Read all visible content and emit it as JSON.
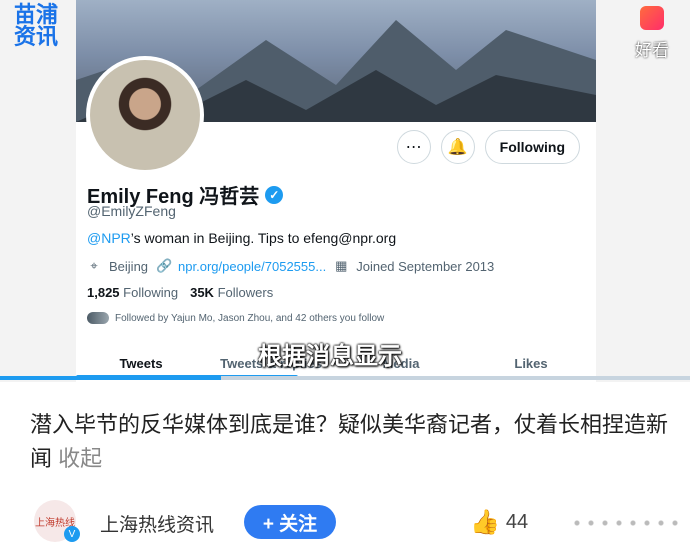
{
  "video": {
    "watermark_left": "苗浦\n资讯",
    "watermark_right": "好看",
    "subtitle": "根据消息显示",
    "progress_percent": 32
  },
  "profile": {
    "name": "Emily Feng 冯哲芸",
    "handle": "@EmilyZFeng",
    "bio_prefix": "@NPR",
    "bio_rest": "’s woman in Beijing. Tips to efeng@npr.org",
    "location": "Beijing",
    "link": "npr.org/people/7052555...",
    "joined": "Joined September 2013",
    "following_count": "1,825",
    "following_label": "Following",
    "followers_count": "35K",
    "followers_label": "Followers",
    "followed_by": "Followed by Yajun Mo, Jason Zhou, and 42 others you follow",
    "following_button": "Following",
    "tabs": [
      "Tweets",
      "Tweets & replies",
      "Media",
      "Likes"
    ]
  },
  "article": {
    "title": "潜入毕节的反华媒体到底是谁？疑似美华裔记者，仗着长相捏造新闻",
    "collapse": "收起"
  },
  "footer": {
    "source_name": "上海热线资讯",
    "follow_label": "+ 关注",
    "likes": "44"
  }
}
